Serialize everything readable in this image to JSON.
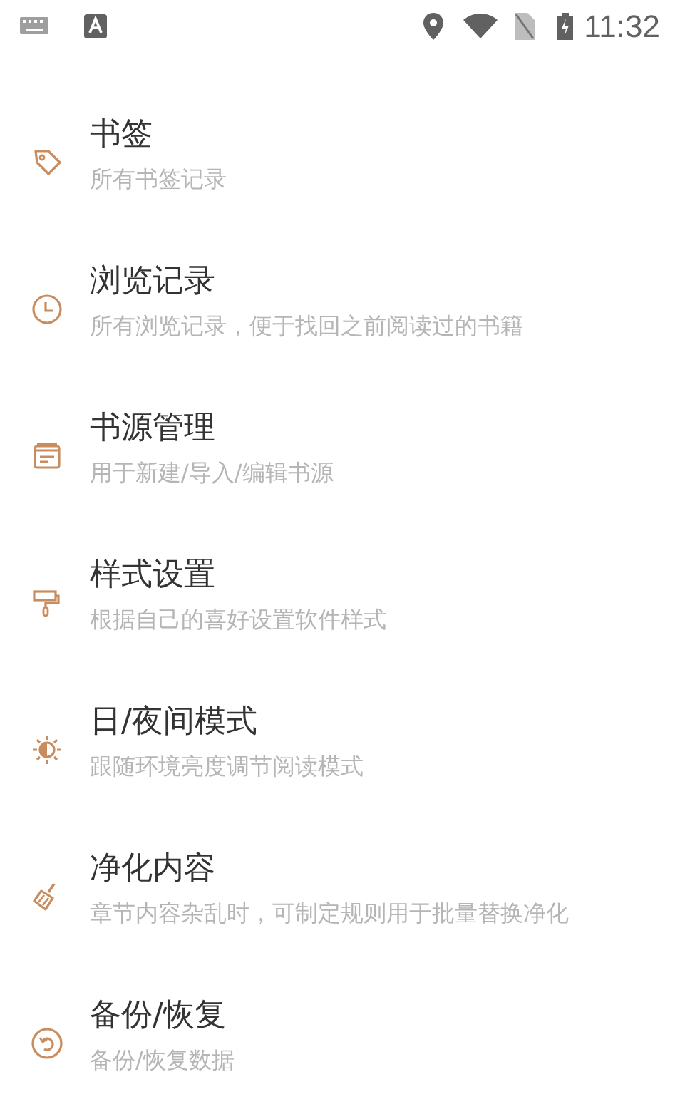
{
  "status_bar": {
    "time": "11:32"
  },
  "items": [
    {
      "title": "书签",
      "subtitle": "所有书签记录"
    },
    {
      "title": "浏览记录",
      "subtitle": "所有浏览记录，便于找回之前阅读过的书籍"
    },
    {
      "title": "书源管理",
      "subtitle": "用于新建/导入/编辑书源"
    },
    {
      "title": "样式设置",
      "subtitle": "根据自己的喜好设置软件样式"
    },
    {
      "title": "日/夜间模式",
      "subtitle": "跟随环境亮度调节阅读模式"
    },
    {
      "title": "净化内容",
      "subtitle": "章节内容杂乱时，可制定规则用于批量替换净化"
    },
    {
      "title": "备份/恢复",
      "subtitle": "备份/恢复数据"
    }
  ]
}
